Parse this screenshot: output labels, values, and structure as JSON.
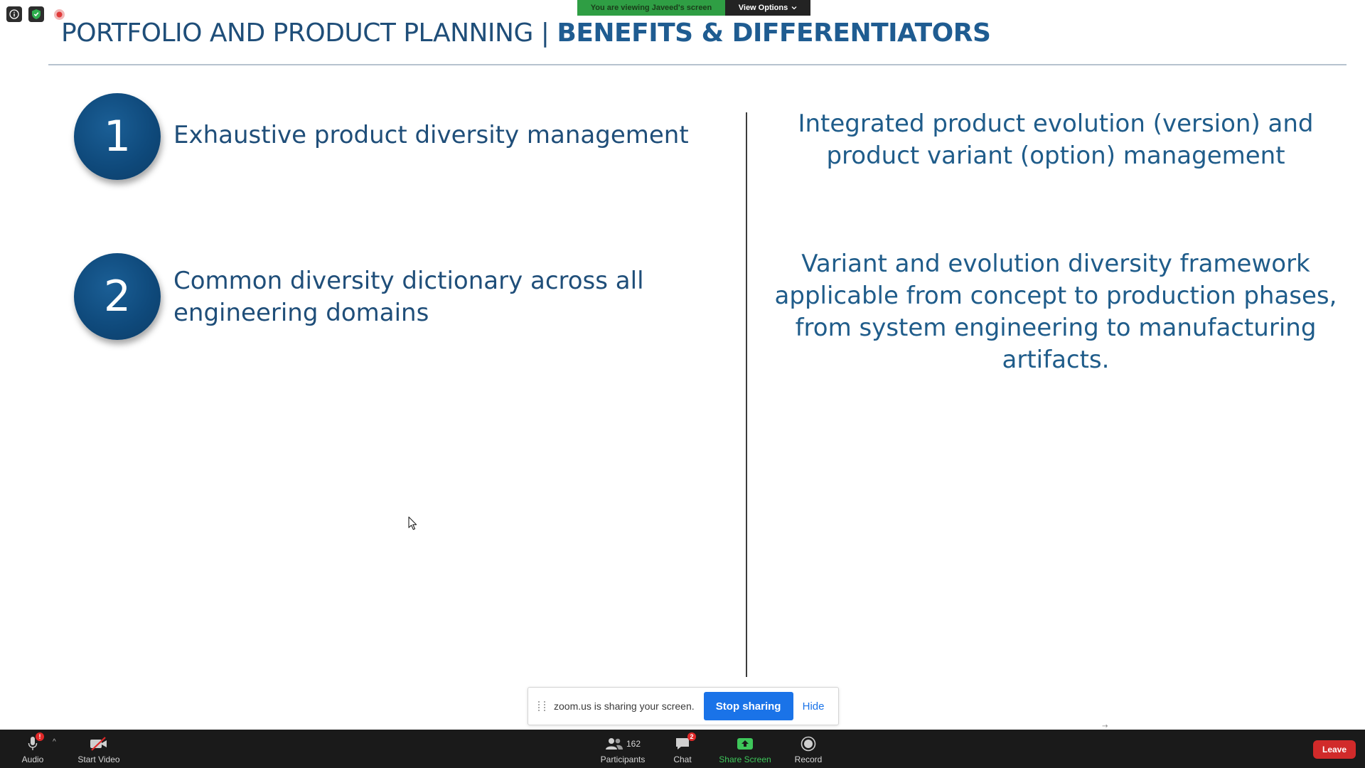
{
  "banner": {
    "viewing_text": "You are viewing Javeed's screen",
    "view_options_label": "View Options"
  },
  "slide": {
    "title_main": "PORTFOLIO AND PRODUCT PLANNING | ",
    "title_emphasis": "BENEFITS & DIFFERENTIATORS",
    "items": [
      {
        "number": "1",
        "text": "Exhaustive product diversity management"
      },
      {
        "number": "2",
        "text": "Common diversity dictionary across all engineering domains"
      }
    ],
    "right_texts": [
      "Integrated product evolution (version) and product variant (option) management",
      "Variant and evolution diversity framework applicable from concept to production phases,  from system engineering to manufacturing artifacts."
    ]
  },
  "share_notice": {
    "message": "zoom.us is sharing your screen.",
    "stop_label": "Stop sharing",
    "hide_label": "Hide"
  },
  "toolbar": {
    "audio_label": "Audio",
    "audio_badge": "!",
    "video_label": "Start Video",
    "participants_label": "Participants",
    "participants_count": "162",
    "chat_label": "Chat",
    "chat_badge": "2",
    "share_label": "Share Screen",
    "record_label": "Record",
    "leave_label": "Leave"
  },
  "icons": {
    "top_left": [
      "info-icon",
      "shield-icon",
      "recording-icon"
    ],
    "toolbar": [
      "microphone-icon",
      "video-off-icon",
      "participants-icon",
      "chat-icon",
      "share-screen-icon",
      "record-icon"
    ]
  },
  "colors": {
    "title_blue": "#1f4e79",
    "badge_blue": "#0f4a7c",
    "banner_green": "#2f9e44",
    "share_green": "#3ec65a",
    "stop_blue": "#1a73e8",
    "leave_red": "#d12a2a",
    "toolbar_bg": "#1a1a1a"
  }
}
